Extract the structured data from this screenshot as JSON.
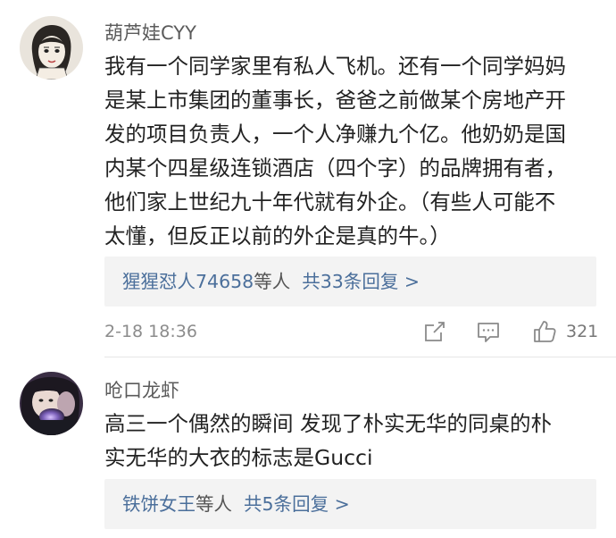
{
  "comments": [
    {
      "username": "葫芦娃CYY",
      "lines": [
        "我有一个同学家里有私人飞机。还有一个同学妈妈",
        "是某上市集团的董事长，爸爸之前做某个房地产开",
        "发的项目负责人，一个人净赚九个亿。他奶奶是国",
        "内某个四星级连锁酒店（四个字）的品牌拥有者，",
        "他们家上世纪九十年代就有外企。（有些人可能不",
        "太懂，但反正以前的外企是真的牛。）"
      ],
      "replies": {
        "names": "猩猩怼人74658",
        "suffix": "等人",
        "count_text": "共33条回复",
        "arrow": ">"
      },
      "timestamp": "2-18 18:36",
      "like_count": "321"
    },
    {
      "username": "呛口龙虾",
      "lines": [
        "高三一个偶然的瞬间 发现了朴实无华的同桌的朴",
        "实无华的大衣的标志是Gucci"
      ],
      "replies": {
        "names": "铁饼女王",
        "suffix": "等人",
        "count_text": "共5条回复",
        "arrow": ">"
      }
    }
  ],
  "icons": {
    "forward": "share-icon",
    "comment": "comment-icon",
    "like": "thumbs-up-icon"
  },
  "colors": {
    "link_blue": "#4b6f9b",
    "reply_box_bg": "#f3f3f3",
    "meta_gray": "#8c8c8c"
  }
}
